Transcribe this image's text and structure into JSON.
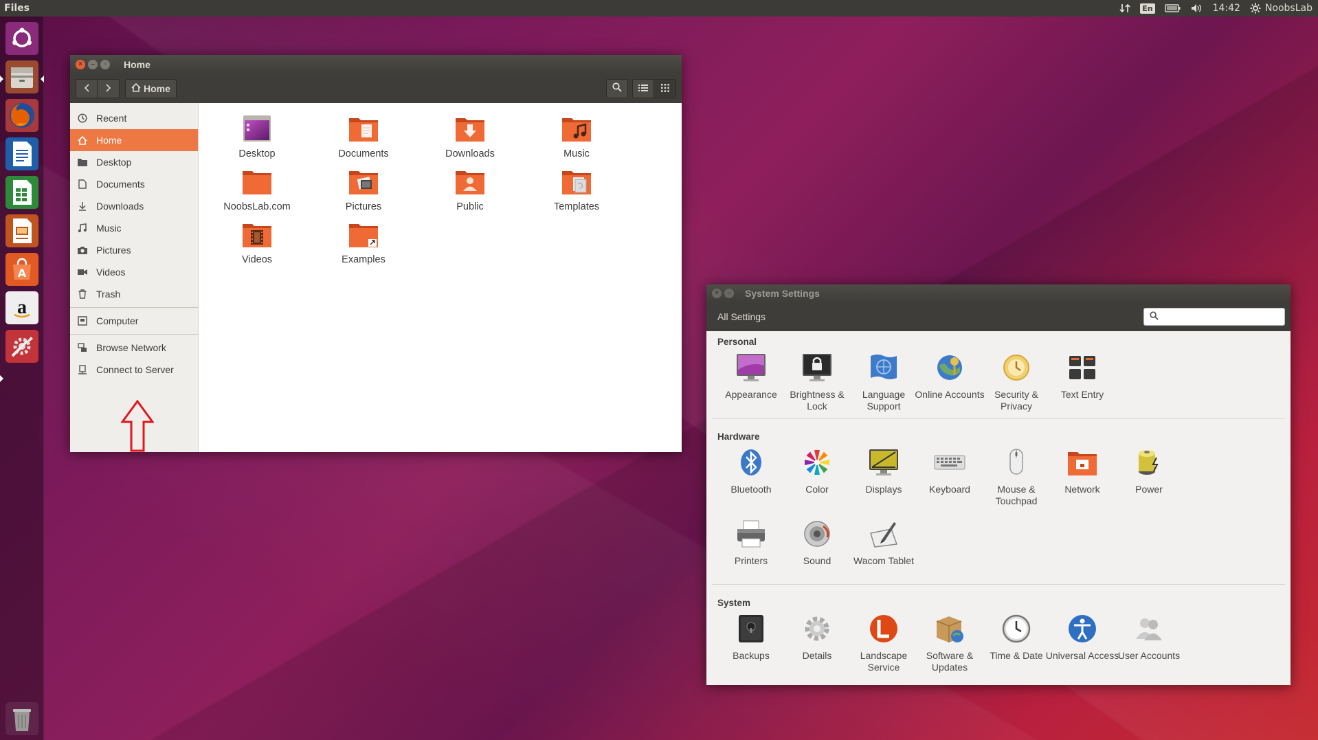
{
  "top_panel": {
    "app_name": "Files",
    "keyboard_layout": "En",
    "clock": "14:42",
    "user": "NoobsLab"
  },
  "launcher": {
    "items": [
      "ubuntu-dash-icon",
      "files-icon",
      "firefox-icon",
      "writer-icon",
      "calc-icon",
      "impress-icon",
      "software-center-icon",
      "amazon-icon",
      "system-settings-icon",
      "trash-icon"
    ]
  },
  "files_window": {
    "title": "Home",
    "path_button": "Home",
    "sidebar": {
      "items": [
        {
          "label": "Recent",
          "icon": "clock-icon"
        },
        {
          "label": "Home",
          "icon": "home-icon",
          "active": true
        },
        {
          "label": "Desktop",
          "icon": "folder-icon"
        },
        {
          "label": "Documents",
          "icon": "document-icon"
        },
        {
          "label": "Downloads",
          "icon": "download-icon"
        },
        {
          "label": "Music",
          "icon": "music-icon"
        },
        {
          "label": "Pictures",
          "icon": "camera-icon"
        },
        {
          "label": "Videos",
          "icon": "video-icon"
        },
        {
          "label": "Trash",
          "icon": "trash-icon"
        }
      ],
      "devices": [
        {
          "label": "Computer",
          "icon": "computer-icon"
        }
      ],
      "network": [
        {
          "label": "Browse Network",
          "icon": "network-icon"
        },
        {
          "label": "Connect to Server",
          "icon": "server-icon"
        }
      ]
    },
    "files": [
      {
        "label": "Desktop"
      },
      {
        "label": "Documents"
      },
      {
        "label": "Downloads"
      },
      {
        "label": "Music"
      },
      {
        "label": "NoobsLab.com"
      },
      {
        "label": "Pictures"
      },
      {
        "label": "Public"
      },
      {
        "label": "Templates"
      },
      {
        "label": "Videos"
      },
      {
        "label": "Examples"
      }
    ]
  },
  "settings_window": {
    "title": "System Settings",
    "all_settings": "All Settings",
    "search_placeholder": "",
    "sections": [
      {
        "title": "Personal",
        "items": [
          {
            "label": "Appearance"
          },
          {
            "label": "Brightness & Lock"
          },
          {
            "label": "Language Support"
          },
          {
            "label": "Online Accounts"
          },
          {
            "label": "Security & Privacy"
          },
          {
            "label": "Text Entry"
          }
        ]
      },
      {
        "title": "Hardware",
        "items": [
          {
            "label": "Bluetooth"
          },
          {
            "label": "Color"
          },
          {
            "label": "Displays"
          },
          {
            "label": "Keyboard"
          },
          {
            "label": "Mouse & Touchpad"
          },
          {
            "label": "Network"
          },
          {
            "label": "Power"
          },
          {
            "label": "Printers"
          },
          {
            "label": "Sound"
          },
          {
            "label": "Wacom Tablet"
          }
        ]
      },
      {
        "title": "System",
        "items": [
          {
            "label": "Backups"
          },
          {
            "label": "Details"
          },
          {
            "label": "Landscape Service"
          },
          {
            "label": "Software & Updates"
          },
          {
            "label": "Time & Date"
          },
          {
            "label": "Universal Access"
          },
          {
            "label": "User Accounts"
          }
        ]
      }
    ]
  },
  "colors": {
    "accent": "#ee7843",
    "panel": "#3c3b37",
    "folder_orange": "#e0592a"
  }
}
